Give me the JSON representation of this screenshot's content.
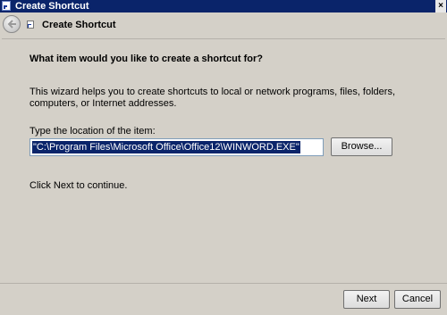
{
  "window": {
    "title": "Create Shortcut",
    "close_glyph": "×"
  },
  "nav": {
    "title": "Create Shortcut"
  },
  "main": {
    "heading": "What item would you like to create a shortcut for?",
    "description": "This wizard helps you to create shortcuts to local or network programs, files, folders, computers, or Internet addresses.",
    "location_label": "Type the location of the item:",
    "location_value": "\"C:\\Program Files\\Microsoft Office\\Office12\\WINWORD.EXE\"",
    "browse_label": "Browse...",
    "continue_text": "Click Next to continue."
  },
  "footer": {
    "next_label": "Next",
    "cancel_label": "Cancel"
  },
  "colors": {
    "titlebar": "#0a246a",
    "selection": "#0a246a",
    "background": "#d4d0c8"
  },
  "icons": [
    "shortcut-icon",
    "back-arrow-icon",
    "close-icon"
  ]
}
